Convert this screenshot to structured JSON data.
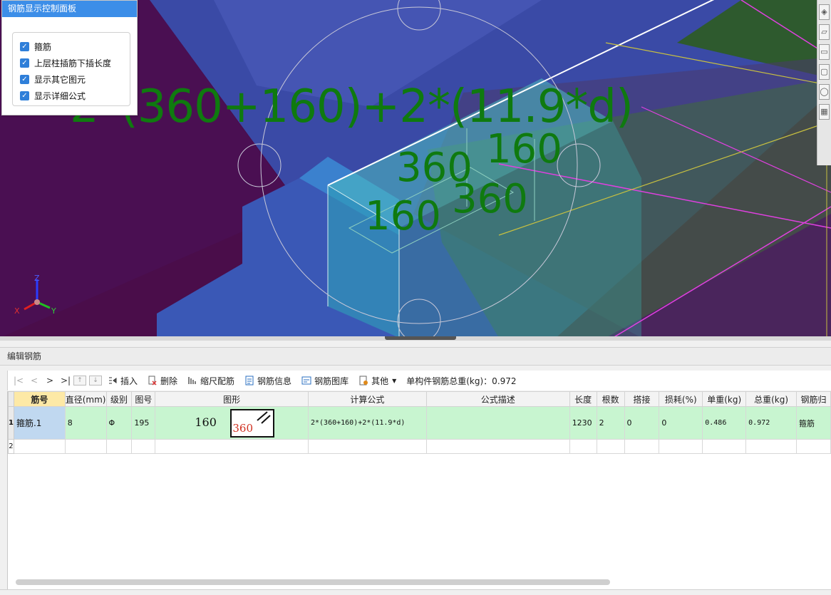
{
  "control_panel": {
    "title": "钢筋显示控制面板",
    "options": [
      {
        "label": "箍筋",
        "checked": true
      },
      {
        "label": "上层柱插筋下插长度",
        "checked": true
      },
      {
        "label": "显示其它图元",
        "checked": true
      },
      {
        "label": "显示详细公式",
        "checked": true
      }
    ]
  },
  "viewport": {
    "formula_overlay": "2*(360+160)+2*(11.9*d)",
    "dim_labels": [
      "160",
      "360",
      "160",
      "360"
    ],
    "axis": {
      "x": "X",
      "y": "Y",
      "z": "Z"
    }
  },
  "edit_panel": {
    "title": "编辑钢筋",
    "toolbar": {
      "nav_first": "|<",
      "nav_prev": "<",
      "nav_next": ">",
      "nav_last": ">|",
      "insert": "插入",
      "delete": "删除",
      "scale_rebar": "缩尺配筋",
      "rebar_info": "钢筋信息",
      "rebar_library": "钢筋图库",
      "other": "其他",
      "total_weight_label": "单构件钢筋总重(kg)：0.972"
    },
    "table": {
      "columns": [
        "筋号",
        "直径(mm)",
        "级别",
        "图号",
        "图形",
        "计算公式",
        "公式描述",
        "长度",
        "根数",
        "搭接",
        "损耗(%)",
        "单重(kg)",
        "总重(kg)",
        "钢筋归"
      ],
      "rows": [
        {
          "no": "1",
          "bar_no": "箍筋.1",
          "diameter": "8",
          "grade": "Φ",
          "figure_no": "195",
          "shape_a": "160",
          "shape_b": "360",
          "formula": "2*(360+160)+2*(11.9*d)",
          "desc": "",
          "length": "1230",
          "count": "2",
          "lap": "0",
          "loss": "0",
          "unit_weight": "0.486",
          "total_weight": "0.972",
          "category": "箍筋"
        },
        {
          "no": "2"
        }
      ]
    }
  },
  "colors": {
    "accent": "#3c8ee8",
    "row_highlight": "#c8f5d0",
    "selected_cell": "#c0d8f0",
    "header_highlight": "#fde9a6",
    "overlay_text": "#0f7a0f"
  }
}
